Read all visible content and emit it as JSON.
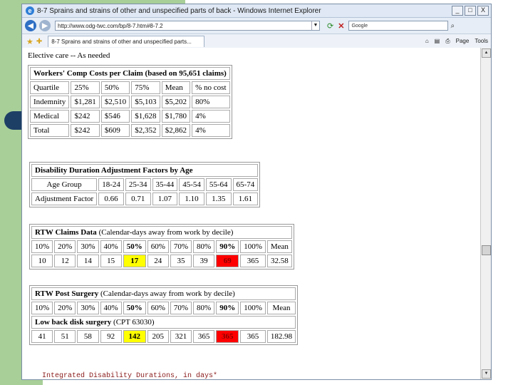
{
  "browser": {
    "title": "8-7 Sprains and strains of other and unspecified parts of back - Windows Internet Explorer",
    "url": "http://www.odg-twc.com/bp/8-7.htm#8-7.2",
    "search_placeholder": "Google",
    "tab_label": "8-7 Sprains and strains of other and unspecified parts...",
    "toolbar": {
      "page": "Page",
      "tools": "Tools"
    },
    "winbtns": {
      "min": "_",
      "max": "□",
      "close": "X"
    }
  },
  "page": {
    "heading": "Elective care -- As needed",
    "footer_note": "Integrated Disability Durations, in days*"
  },
  "costs": {
    "caption": "Workers' Comp Costs per Claim (based on 95,651 claims)",
    "headers": [
      "Quartile",
      "25%",
      "50%",
      "75%",
      "Mean",
      "% no cost"
    ],
    "rows": [
      [
        "Indemnity",
        "$1,281",
        "$2,510",
        "$5,103",
        "$5,202",
        "80%"
      ],
      [
        "Medical",
        "$242",
        "$546",
        "$1,628",
        "$1,780",
        "4%"
      ],
      [
        "Total",
        "$242",
        "$609",
        "$2,352",
        "$2,862",
        "4%"
      ]
    ]
  },
  "duration": {
    "caption": "Disability Duration Adjustment Factors by Age",
    "headers": [
      "Age Group",
      "18-24",
      "25-34",
      "35-44",
      "45-54",
      "55-64",
      "65-74"
    ],
    "row": [
      "Adjustment Factor",
      "0.66",
      "0.71",
      "1.07",
      "1.10",
      "1.35",
      "1.61"
    ]
  },
  "rtw_claims": {
    "caption_bold": "RTW Claims Data",
    "caption_rest": " (Calendar-days away from work by decile)",
    "headers": [
      "10%",
      "20%",
      "30%",
      "40%",
      "50%",
      "60%",
      "70%",
      "80%",
      "90%",
      "100%",
      "Mean"
    ],
    "values": [
      "10",
      "12",
      "14",
      "15",
      "17",
      "24",
      "35",
      "39",
      "69",
      "365",
      "32.58"
    ]
  },
  "rtw_surgery": {
    "caption_bold": "RTW Post Surgery",
    "caption_rest": " (Calendar-days away from work by decile)",
    "headers": [
      "10%",
      "20%",
      "30%",
      "40%",
      "50%",
      "60%",
      "70%",
      "80%",
      "90%",
      "100%",
      "Mean"
    ],
    "subcaption_bold": "Low back disk surgery",
    "subcaption_rest": " (CPT 63030)",
    "values": [
      "41",
      "51",
      "58",
      "92",
      "142",
      "205",
      "321",
      "365",
      "365",
      "365",
      "182.98"
    ]
  },
  "colors": {
    "median_highlight": "#ffff00",
    "p90_highlight": "#ff0000",
    "slide_green": "#a8cf98",
    "slide_navy": "#1d3f66"
  }
}
